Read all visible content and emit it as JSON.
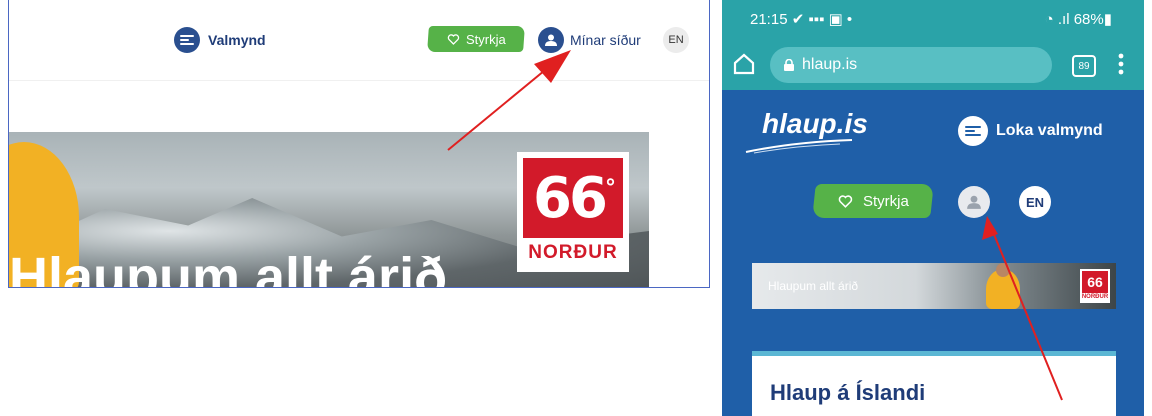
{
  "desktop": {
    "menu_label": "Valmynd",
    "donate_label": "Styrkja",
    "my_pages_label": "Mínar síður",
    "lang_label": "EN",
    "banner_text": "Hlaupum allt árið",
    "sponsor_logo_number": "66",
    "sponsor_logo_degree": "°",
    "sponsor_logo_name": "NORÐUR"
  },
  "phone": {
    "status_time": "21:15",
    "status_battery": "68%",
    "url": "hlaup.is",
    "tab_count": "89",
    "brand": "hlaup.is",
    "close_menu_label": "Loka valmynd",
    "donate_label": "Styrkja",
    "lang_label": "EN",
    "banner_text": "Hlaupum allt árið",
    "sponsor_logo_number": "66",
    "sponsor_logo_name": "NORÐUR",
    "card_title": "Hlaup á Íslandi"
  },
  "colors": {
    "brand_blue": "#1f5fa8",
    "dark_blue": "#2a4f8f",
    "donate_green": "#56b248",
    "arrow_red": "#e02020",
    "sponsor_red": "#d21a2a",
    "browser_teal": "#2aa3a8"
  },
  "icons": [
    "menu-icon",
    "heart-icon",
    "user-icon",
    "home-icon",
    "lock-icon",
    "more-vert-icon",
    "annotation-arrow"
  ]
}
